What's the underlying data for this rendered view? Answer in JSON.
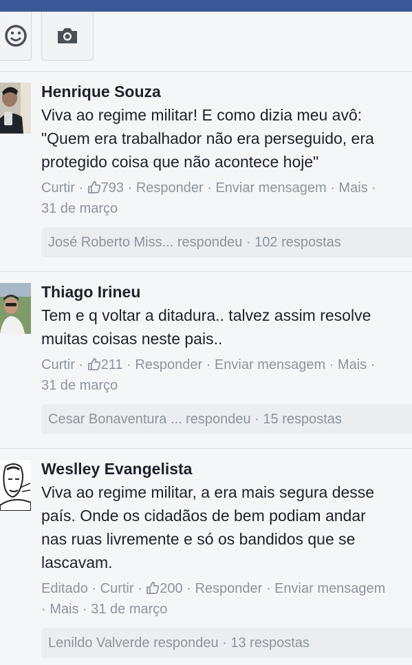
{
  "toolbar": {
    "emoji_icon": "smiley-face-icon",
    "camera_icon": "camera-icon"
  },
  "comments": [
    {
      "author": "Henrique Souza",
      "lines": [
        "Viva ao regime militar! E como dizia meu avô:",
        "\"Quem era trabalhador não era perseguido, era",
        "protegido coisa que não acontece hoje\""
      ],
      "edited": "",
      "like": "Curtir",
      "like_count": "793",
      "reply": "Responder",
      "message": "Enviar mensagem",
      "more": "Mais",
      "date": "31 de março",
      "replies_summary": "José Roberto Miss... respondeu · 102 respostas"
    },
    {
      "author": "Thiago Irineu",
      "lines": [
        "Tem e q voltar a ditadura.. talvez assim resolve",
        "muitas coisas neste pais.."
      ],
      "edited": "",
      "like": "Curtir",
      "like_count": "211",
      "reply": "Responder",
      "message": "Enviar mensagem",
      "more": "Mais",
      "date": "31 de março",
      "replies_summary": "Cesar Bonaventura ... respondeu · 15 respostas"
    },
    {
      "author": "Weslley Evangelista",
      "lines": [
        "Viva ao regime militar, a era mais segura desse",
        "país. Onde os cidadãos de bem podiam andar",
        "nas ruas livremente e só os bandidos que se",
        "lascavam."
      ],
      "edited": "Editado",
      "like": "Curtir",
      "like_count": "200",
      "reply": "Responder",
      "message": "Enviar mensagem",
      "more": "Mais",
      "date": "31 de março",
      "replies_summary": "Lenildo Valverde respondeu · 13 respostas"
    }
  ]
}
